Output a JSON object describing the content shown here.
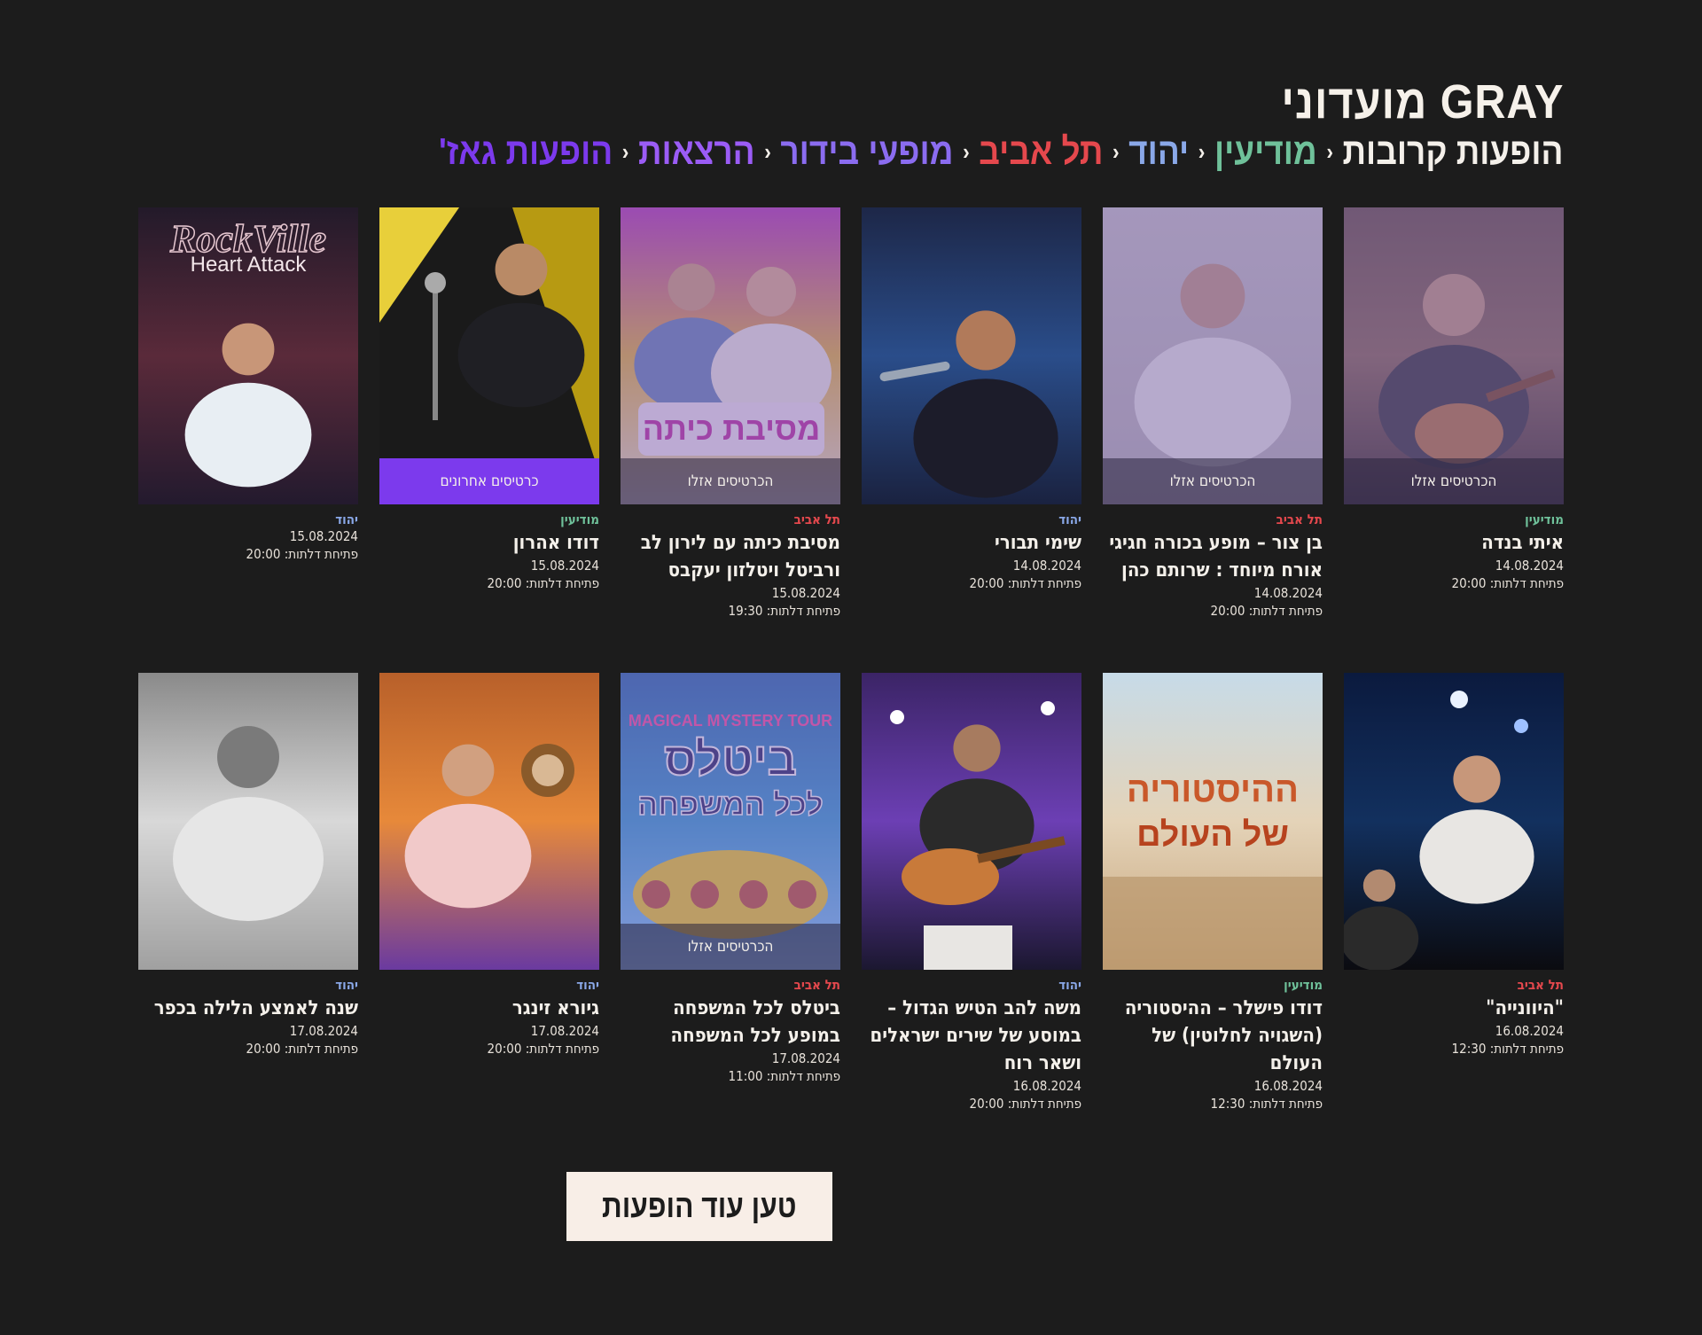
{
  "brand": "GRAY מועדוני",
  "breadcrumb": [
    {
      "label": "הופעות קרובות",
      "color": "#f4f0ea"
    },
    {
      "label": "מודיעין",
      "color": "#6fc19a"
    },
    {
      "label": "יהוד",
      "color": "#8aa8e8"
    },
    {
      "label": "תל אביב",
      "color": "#e5484d"
    },
    {
      "label": "מופעי בידור",
      "color": "#8b6cf0"
    },
    {
      "label": "הרצאות",
      "color": "#9b5cf6"
    },
    {
      "label": "הופעות גאז'",
      "color": "#7c3aed"
    }
  ],
  "colors": {
    "modiin": "#6fc19a",
    "yehud": "#8aa8e8",
    "telaviv": "#e5484d",
    "background": "#1c1c1c",
    "accent": "#7c3aed"
  },
  "events": [
    {
      "city": "מודיעין",
      "cityKey": "modiin",
      "title": "איתי בנדה",
      "date": "14.08.2024",
      "doors": "פתיחת דלתות: 20:00",
      "status": "הכרטיסים אזלו",
      "art": "guitar-warm"
    },
    {
      "city": "תל אביב",
      "cityKey": "telaviv",
      "title": "בן צור – מופע בכורה חגיגי אורח מיוחד : שרותם כהן",
      "date": "14.08.2024",
      "doors": "פתיחת דלתות: 20:00",
      "status": "הכרטיסים אזלו",
      "art": "portrait-light"
    },
    {
      "city": "יהוד",
      "cityKey": "yehud",
      "title": "שימי תבורי",
      "date": "14.08.2024",
      "doors": "פתיחת דלתות: 20:00",
      "status": "",
      "art": "singer-blue"
    },
    {
      "city": "תל אביב",
      "cityKey": "telaviv",
      "title": "מסיבת כיתה עם לירון לב ורביטל ויטלזון יעקבס",
      "date": "15.08.2024",
      "doors": "פתיחת דלתות: 19:30",
      "status": "הכרטיסים אזלו",
      "art": "party-purple"
    },
    {
      "city": "מודיעין",
      "cityKey": "modiin",
      "title": "דודו אהרון",
      "date": "15.08.2024",
      "doors": "פתיחת דלתות: 20:00",
      "status": "כרטיסים אחרונים",
      "statusLast": true,
      "art": "mic-yellow"
    },
    {
      "city": "יהוד",
      "cityKey": "yehud",
      "title": "",
      "date": "15.08.2024",
      "doors": "פתיחת דלתות: 20:00",
      "status": "",
      "art": "rockville",
      "posterText": "RockVille",
      "posterSub": "Heart Attack"
    },
    {
      "city": "תל אביב",
      "cityKey": "telaviv",
      "title": "\"היוונייה\"",
      "date": "16.08.2024",
      "doors": "פתיחת דלתות: 12:30",
      "status": "",
      "art": "stage-dark"
    },
    {
      "city": "מודיעין",
      "cityKey": "modiin",
      "title": "דודו פישלר – ההיסטוריה (השגויה לחלוטין) של העולם",
      "date": "16.08.2024",
      "doors": "פתיחת דלתות: 12:30",
      "status": "",
      "art": "history-sand",
      "posterText": "ההיסטוריה",
      "posterSub": "של העולם"
    },
    {
      "city": "יהוד",
      "cityKey": "yehud",
      "title": "משה להב הטיש הגדול – במוסע של שירים ישראלים ושאר רוח",
      "date": "16.08.2024",
      "doors": "פתיחת דלתות: 20:00",
      "status": "",
      "art": "concert-purple"
    },
    {
      "city": "תל אביב",
      "cityKey": "telaviv",
      "title": "ביטלס לכל המשפחה במופע לכל המשפחה",
      "date": "17.08.2024",
      "doors": "פתיחת דלתות: 11:00",
      "status": "הכרטיסים אזלו",
      "art": "beatles",
      "posterText": "ביטלס",
      "posterSub": "לכל המשפחה"
    },
    {
      "city": "יהוד",
      "cityKey": "yehud",
      "title": "גיורא זינגר",
      "date": "17.08.2024",
      "doors": "פתיחת דלתות: 20:00",
      "status": "",
      "art": "orange-comic"
    },
    {
      "city": "יהוד",
      "cityKey": "yehud",
      "title": "שנה לאמצע הלילה בכפר",
      "date": "17.08.2024",
      "doors": "פתיחת דלתות: 20:00",
      "status": "",
      "art": "mono-portrait"
    }
  ],
  "loadMore": "טען עוד הופעות"
}
